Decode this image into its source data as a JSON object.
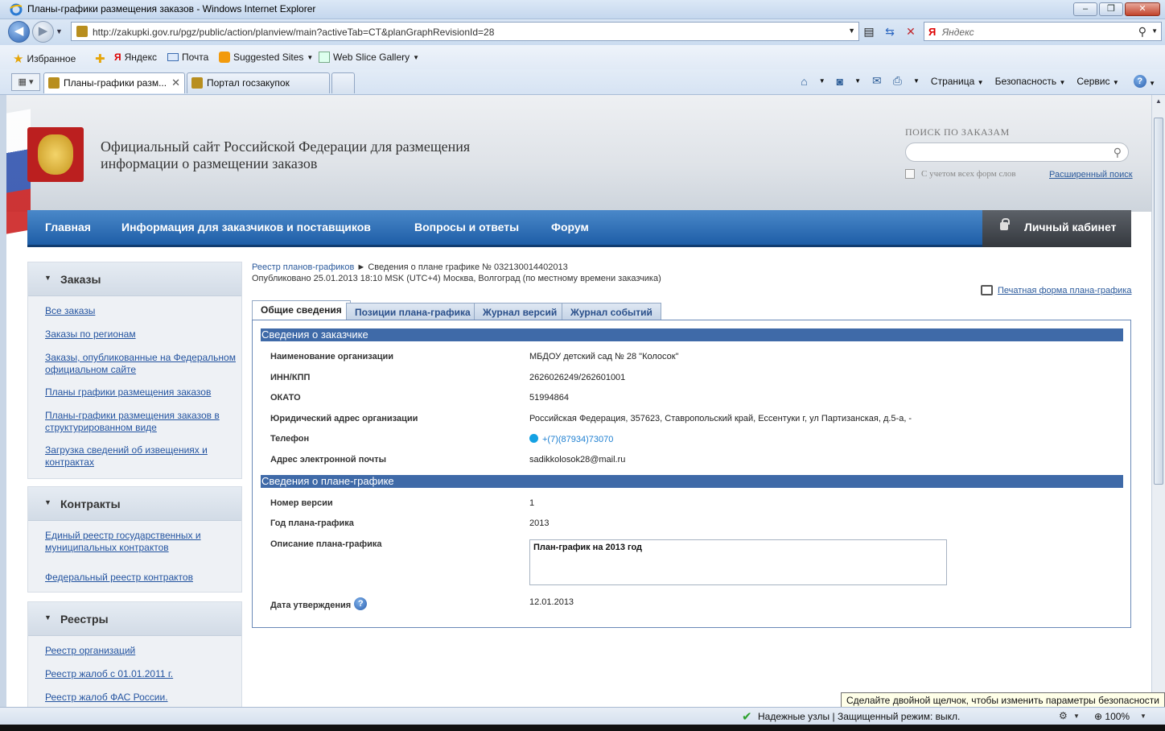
{
  "window": {
    "title": "Планы-графики размещения заказов - Windows Internet Explorer",
    "controls": [
      "‒",
      "❐",
      "✕"
    ]
  },
  "addressbar": {
    "url": "http://zakupki.gov.ru/pgz/public/action/planview/main?activeTab=CT&planGraphRevisionId=28",
    "search_placeholder": "Яндекс"
  },
  "favorites": {
    "favorites_label": "Избранное",
    "items": [
      {
        "label": "Яндекс"
      },
      {
        "label": "Почта"
      },
      {
        "label": "Suggested Sites"
      },
      {
        "label": "Web Slice Gallery"
      }
    ]
  },
  "browser_tabs": [
    {
      "label": "Планы-графики разм..."
    },
    {
      "label": "Портал госзакупок"
    }
  ],
  "commandbar": {
    "page": "Страница",
    "safety": "Безопасность",
    "service": "Сервис"
  },
  "site": {
    "title": "Официальный сайт Российской Федерации для размещения информации о размещении заказов",
    "search_label": "ПОИСК ПО ЗАКАЗАМ",
    "all_forms_label": "С учетом всех форм слов",
    "advanced_search": "Расширенный поиск"
  },
  "mainnav": {
    "items": [
      {
        "label": "Главная"
      },
      {
        "label": "Информация для заказчиков и поставщиков"
      },
      {
        "label": "Вопросы и ответы"
      },
      {
        "label": "Форум"
      }
    ],
    "cabinet": "Личный кабинет"
  },
  "sidebar": [
    {
      "title": "Заказы",
      "links": [
        "Все заказы",
        "Заказы по регионам",
        "Заказы, опубликованные на Федеральном официальном сайте",
        "Планы графики размещения заказов",
        "Планы-графики размещения заказов в структурированном виде",
        "Загрузка сведений об извещениях и контрактах"
      ]
    },
    {
      "title": "Контракты",
      "links": [
        "Единый реестр государственных и муниципальных контрактов",
        "Федеральный реестр контрактов"
      ]
    },
    {
      "title": "Реестры",
      "links": [
        "Реестр организаций",
        "Реестр жалоб с 01.01.2011 г.",
        "Реестр жалоб ФАС России."
      ]
    }
  ],
  "breadcrumb": {
    "link": "Реестр планов-графиков",
    "separator": "►",
    "current": "Сведения о плане графике № 032130014402013"
  },
  "published": "Опубликовано 25.01.2013 18:10 MSK (UTC+4) Москва, Волгоград (по местному времени заказчика)",
  "print_link": "Печатная форма плана-графика",
  "content_tabs": [
    {
      "label": "Общие сведения"
    },
    {
      "label": "Позиции плана-графика"
    },
    {
      "label": "Журнал версий"
    },
    {
      "label": "Журнал событий"
    }
  ],
  "customer_section": {
    "title": "Сведения о заказчике",
    "fields": [
      {
        "label": "Наименование организации",
        "value": "МБДОУ детский сад № 28 \"Колосок\""
      },
      {
        "label": "ИНН/КПП",
        "value": "2626026249/262601001"
      },
      {
        "label": "ОКАТО",
        "value": "51994864"
      },
      {
        "label": "Юридический адрес организации",
        "value": "Российская Федерация, 357623, Ставропольский край, Ессентуки г, ул Партизанская, д.5-а, -"
      },
      {
        "label": "Телефон",
        "value": "+(7)(87934)73070"
      },
      {
        "label": "Адрес электронной почты",
        "value": "sadikkolosok28@mail.ru"
      }
    ]
  },
  "plan_section": {
    "title": "Сведения о плане-графике",
    "version_label": "Номер версии",
    "version_value": "1",
    "year_label": "Год плана-графика",
    "year_value": "2013",
    "description_label": "Описание плана-графика",
    "description_value": "План-график на 2013 год",
    "approval_label": "Дата утверждения",
    "approval_value": "12.01.2013"
  },
  "status": {
    "tooltip": "Сделайте двойной щелчок, чтобы изменить параметры безопасности",
    "zone": "Надежные узлы | Защищенный режим: выкл.",
    "zoom": "100%"
  }
}
